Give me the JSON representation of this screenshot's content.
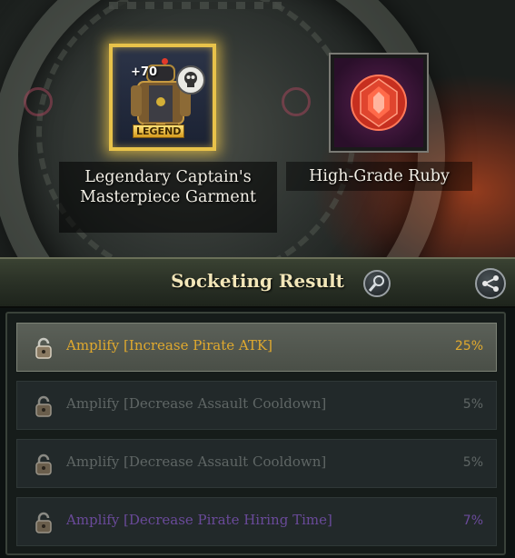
{
  "items": {
    "garment": {
      "name": "Legendary Captain's Masterpiece Garment",
      "enhance_level": "+70",
      "grade_tag": "LEGEND"
    },
    "gem": {
      "name": "High-Grade Ruby"
    }
  },
  "header": {
    "title": "Socketing Result",
    "inspect_icon": "magnifier-icon",
    "share_icon": "share-icon"
  },
  "results": [
    {
      "label": "Amplify [Increase Pirate ATK]",
      "value": "25%",
      "color": "#e0a92e",
      "active": true
    },
    {
      "label": "Amplify [Decrease Assault Cooldown]",
      "value": "5%",
      "color": "#5f6665",
      "active": false
    },
    {
      "label": "Amplify [Decrease Assault Cooldown]",
      "value": "5%",
      "color": "#5f6665",
      "active": false
    },
    {
      "label": "Amplify [Decrease Pirate Hiring Time]",
      "value": "7%",
      "color": "#6a4a9a",
      "active": false
    }
  ],
  "colors": {
    "legend_gold": "#e8c24a",
    "header_text": "#f2e6b8"
  }
}
